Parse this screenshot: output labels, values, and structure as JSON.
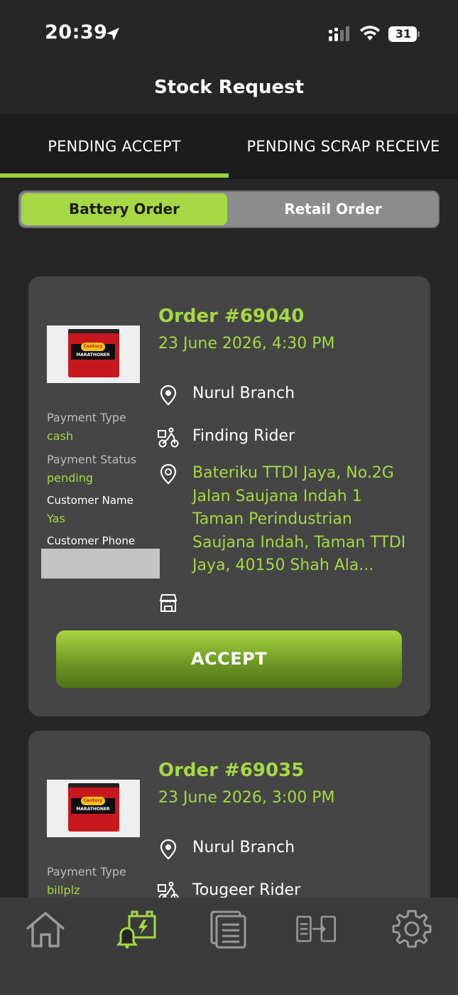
{
  "status_bar": {
    "time": "20:39",
    "battery_level": "31"
  },
  "header": {
    "title": "Stock Request"
  },
  "tabs": [
    {
      "label": "PENDING ACCEPT",
      "active": true
    },
    {
      "label": "PENDING SCRAP RECEIVE",
      "active": false
    }
  ],
  "segment": [
    {
      "label": "Battery Order",
      "active": true
    },
    {
      "label": "Retail Order",
      "active": false
    }
  ],
  "orders": [
    {
      "order_no": "Order #69040",
      "date": "23 June 2026, 4:30 PM",
      "payment_type_label": "Payment Type",
      "payment_type": "cash",
      "payment_status_label": "Payment Status",
      "payment_status": "pending",
      "customer_name_label": "Customer Name",
      "customer_name": "Yas",
      "customer_phone_label": "Customer Phone",
      "branch": "Nurul Branch",
      "rider": "Finding Rider",
      "address": "Bateriku TTDI Jaya, No.2G Jalan Saujana Indah 1 Taman Perindustrian Saujana Indah, Taman TTDI Jaya, 40150 Shah Ala...",
      "accept_label": "ACCEPT"
    },
    {
      "order_no": "Order #69035",
      "date": "23 June 2026, 3:00 PM",
      "payment_type_label": "Payment Type",
      "payment_type": "billplz",
      "branch": "Nurul Branch",
      "rider": "Tougeer Rider"
    }
  ],
  "product": {
    "brand": "Century",
    "model": "MARATHONER"
  },
  "nav": [
    {
      "icon": "home-icon",
      "active": false
    },
    {
      "icon": "stock-request-icon",
      "active": true
    },
    {
      "icon": "documents-icon",
      "active": false
    },
    {
      "icon": "transfer-icon",
      "active": false
    },
    {
      "icon": "settings-icon",
      "active": false
    }
  ],
  "colors": {
    "accent": "#a6d843",
    "background": "#262626",
    "card": "#454545"
  }
}
